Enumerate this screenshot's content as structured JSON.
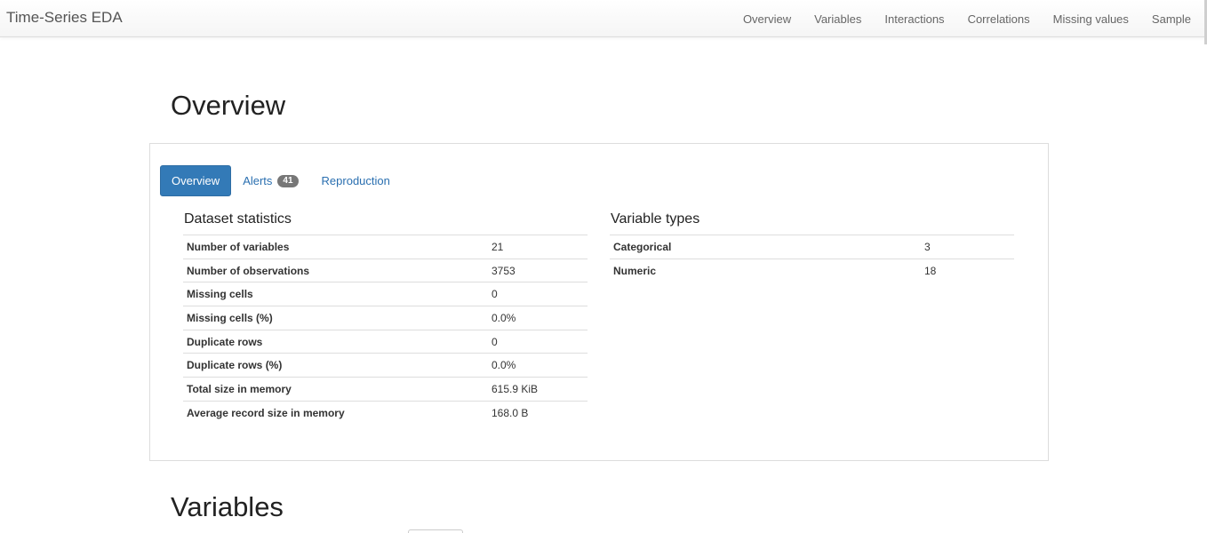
{
  "app": {
    "title": "Time-Series EDA"
  },
  "nav": {
    "items": [
      {
        "label": "Overview"
      },
      {
        "label": "Variables"
      },
      {
        "label": "Interactions"
      },
      {
        "label": "Correlations"
      },
      {
        "label": "Missing values"
      },
      {
        "label": "Sample"
      }
    ]
  },
  "overview": {
    "heading": "Overview",
    "tabs": [
      {
        "label": "Overview",
        "active": true
      },
      {
        "label": "Alerts",
        "badge": "41"
      },
      {
        "label": "Reproduction"
      }
    ],
    "dataset_statistics": {
      "title": "Dataset statistics",
      "rows": [
        {
          "label": "Number of variables",
          "value": "21"
        },
        {
          "label": "Number of observations",
          "value": "3753"
        },
        {
          "label": "Missing cells",
          "value": "0"
        },
        {
          "label": "Missing cells (%)",
          "value": "0.0%"
        },
        {
          "label": "Duplicate rows",
          "value": "0"
        },
        {
          "label": "Duplicate rows (%)",
          "value": "0.0%"
        },
        {
          "label": "Total size in memory",
          "value": "615.9 KiB"
        },
        {
          "label": "Average record size in memory",
          "value": "168.0 B"
        }
      ]
    },
    "variable_types": {
      "title": "Variable types",
      "rows": [
        {
          "label": "Categorical",
          "value": "3"
        },
        {
          "label": "Numeric",
          "value": "18"
        }
      ]
    }
  },
  "variables": {
    "heading": "Variables"
  },
  "colors": {
    "accent": "#337ab7",
    "link": "#2a6fb0",
    "badge": "#777777"
  }
}
